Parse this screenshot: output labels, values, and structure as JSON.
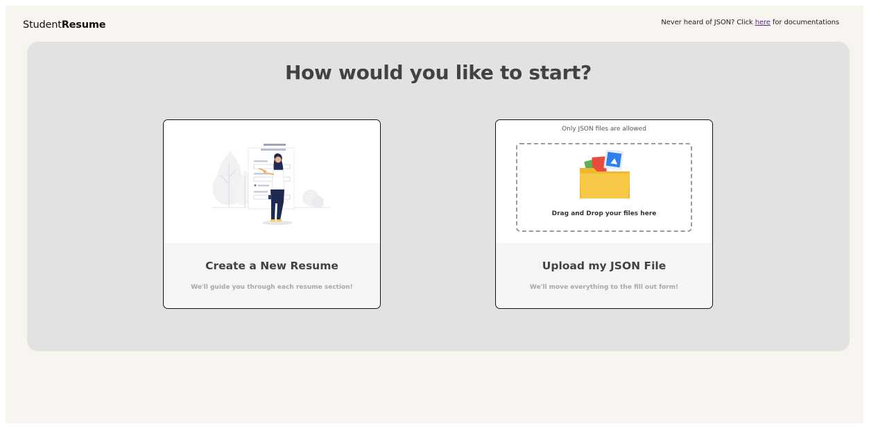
{
  "header": {
    "brand_light": "Student",
    "brand_bold": "Resume",
    "doc_prefix": "Never heard of JSON? Click ",
    "doc_link": "here",
    "doc_suffix": " for documentations"
  },
  "main": {
    "title": "How would you like to start?"
  },
  "cards": {
    "create": {
      "title": "Create a New Resume",
      "subtitle": "We'll guide you through each resume section!",
      "icon": "person-editing-resume-illustration"
    },
    "upload": {
      "note": "Only JSON files are allowed",
      "dropzone_text": "Drag and Drop your files here",
      "title": "Upload my JSON File",
      "subtitle": "We'll move everything to the fill out form!",
      "icon": "folder-icon"
    }
  },
  "colors": {
    "page_bg": "#f8f5f1",
    "panel_bg": "#e2e2e2",
    "card_bg": "#f5f5f5",
    "link": "#5b2a86",
    "folder": "#f7c948"
  }
}
